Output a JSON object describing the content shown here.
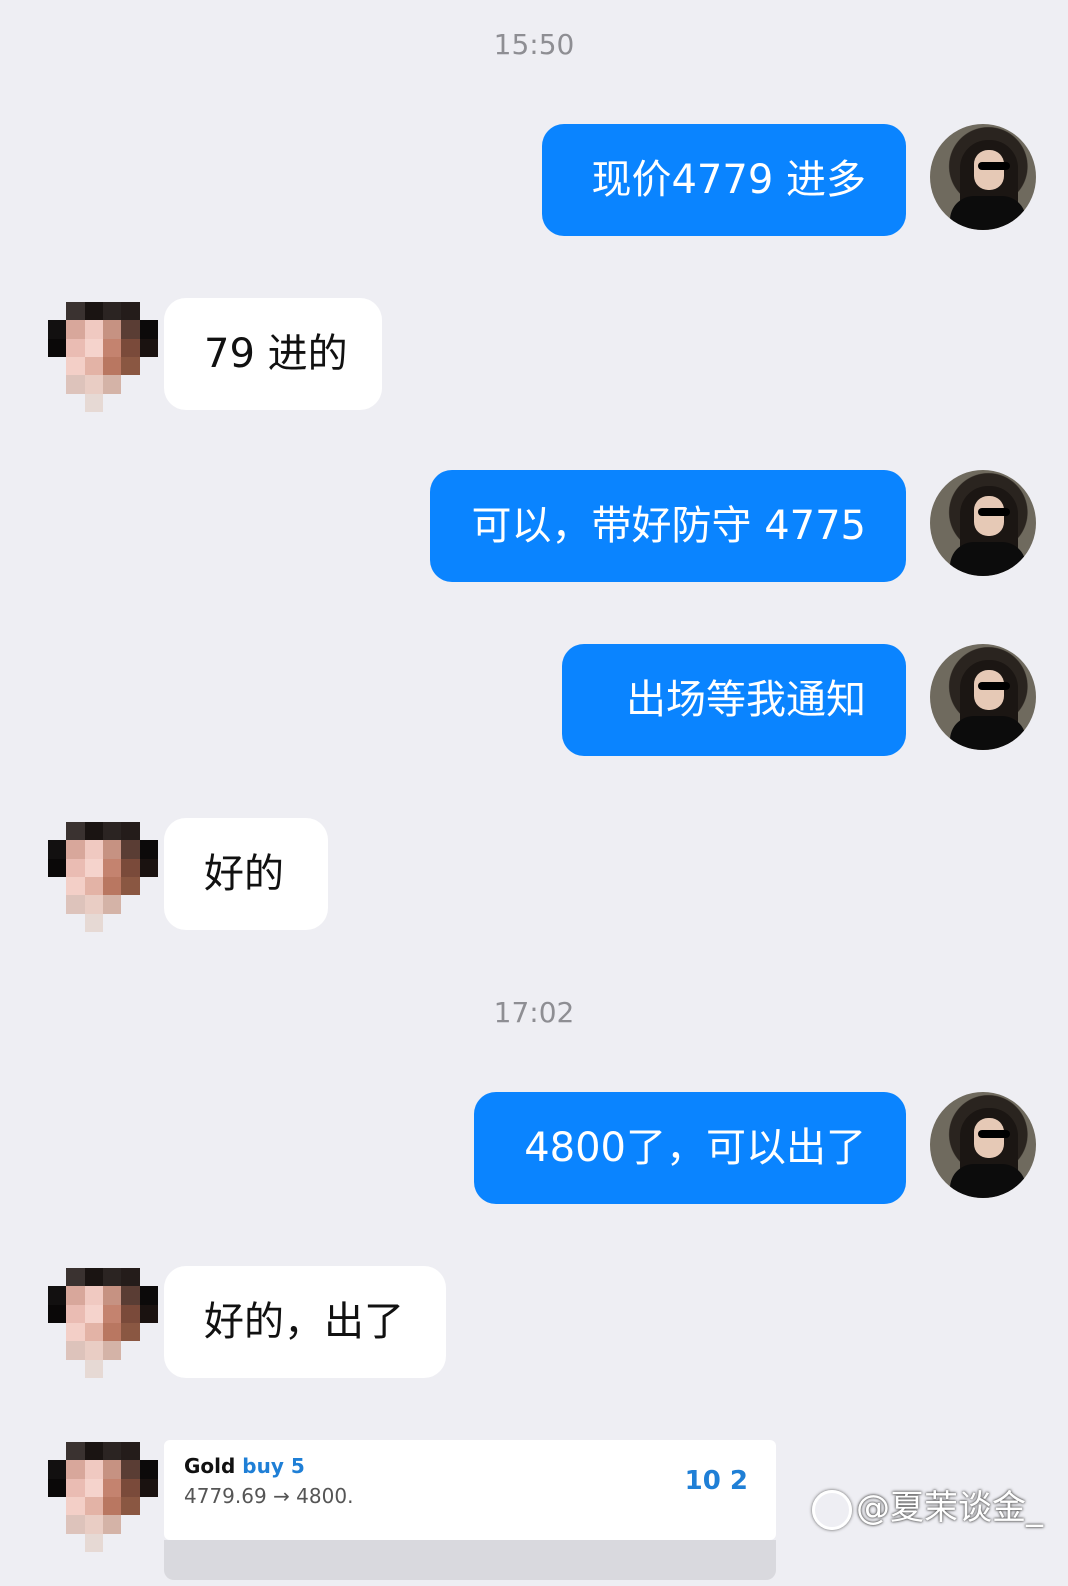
{
  "colors": {
    "background": "#eeeef3",
    "sent_bubble": "#0a84ff",
    "received_bubble": "#ffffff",
    "timestamp": "#8e8e93"
  },
  "timestamps": [
    "15:50",
    "17:02"
  ],
  "messages": [
    {
      "from": "me",
      "text": "现价4779 进多"
    },
    {
      "from": "them",
      "text": "79 进的"
    },
    {
      "from": "me",
      "text": "可以，带好防守 4775"
    },
    {
      "from": "me",
      "text": "出场等我通知"
    },
    {
      "from": "them",
      "text": "好的"
    },
    {
      "from": "me",
      "text": "4800了，可以出了"
    },
    {
      "from": "them",
      "text": "好的，出了"
    }
  ],
  "trade_card": {
    "instrument": "Gold",
    "side": "buy 5",
    "prices": "4779.69 → 4800.",
    "pnl": "10 2"
  },
  "watermark": {
    "icon": "weibo-icon",
    "text": "@夏茉谈金_"
  }
}
